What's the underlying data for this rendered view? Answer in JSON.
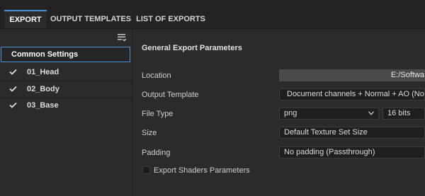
{
  "tabs": [
    {
      "label": "EXPORT",
      "active": true
    },
    {
      "label": "OUTPUT TEMPLATES",
      "active": false
    },
    {
      "label": "LIST OF EXPORTS",
      "active": false
    }
  ],
  "left_panel": {
    "common_settings": "Common Settings",
    "texture_sets": [
      {
        "label": "01_Head",
        "checked": true
      },
      {
        "label": "02_Body",
        "checked": true
      },
      {
        "label": "03_Base",
        "checked": true
      }
    ],
    "menu_icon": "list-options-icon"
  },
  "parameters": {
    "title": "General Export Parameters",
    "location": {
      "label": "Location",
      "value": "E:/Softwa"
    },
    "output_template": {
      "label": "Output Template",
      "value": "Document channels + Normal + AO (No Alph"
    },
    "file_type": {
      "label": "File Type",
      "format": "png",
      "bit_depth": "16 bits"
    },
    "size": {
      "label": "Size",
      "value": "Default Texture Set Size"
    },
    "padding": {
      "label": "Padding",
      "value": "No padding (Passthrough)"
    },
    "export_shaders": {
      "label": "Export Shaders Parameters",
      "checked": false
    }
  },
  "colors": {
    "accent": "#4a90d9",
    "background": "#2b2b2b",
    "tabbar": "#232323"
  }
}
